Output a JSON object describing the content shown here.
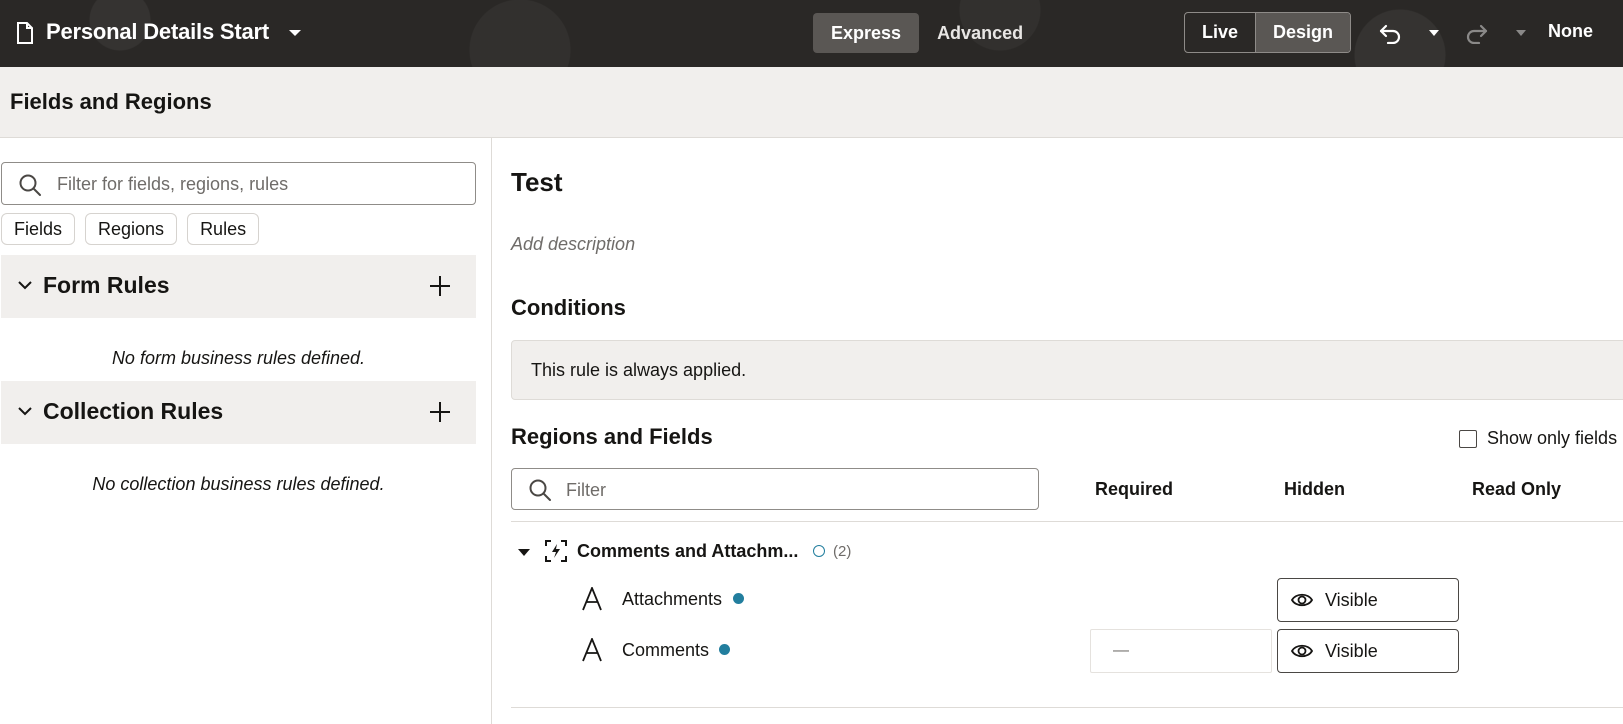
{
  "topbar": {
    "title": "Personal Details Start",
    "modes": [
      "Express",
      "Advanced"
    ],
    "active_mode": "Express",
    "views": [
      "Live",
      "Design"
    ],
    "active_view": "Design",
    "selection_label": "None"
  },
  "subheader": {
    "title": "Fields and Regions"
  },
  "left": {
    "search_placeholder": "Filter for fields, regions, rules",
    "chips": [
      "Fields",
      "Regions",
      "Rules"
    ],
    "form_rules": {
      "title": "Form Rules",
      "empty": "No form business rules defined."
    },
    "collection_rules": {
      "title": "Collection Rules",
      "empty": "No collection business rules defined."
    }
  },
  "main": {
    "title": "Test",
    "description_placeholder": "Add description",
    "conditions": {
      "title": "Conditions",
      "text": "This rule is always applied."
    },
    "regions_fields": {
      "title": "Regions and Fields",
      "show_only_label": "Show only fields",
      "filter_placeholder": "Filter",
      "columns": [
        "Required",
        "Hidden",
        "Read Only"
      ],
      "group": {
        "name": "Comments and Attachm...",
        "count": "(2)"
      },
      "fields": [
        {
          "name": "Attachments",
          "required": "",
          "hidden": "Visible"
        },
        {
          "name": "Comments",
          "required": "—",
          "hidden": "Visible"
        }
      ]
    }
  },
  "colors": {
    "topbar_bg": "#2a2826",
    "accent_teal": "#227e9e",
    "panel_bg": "#f1efed"
  }
}
